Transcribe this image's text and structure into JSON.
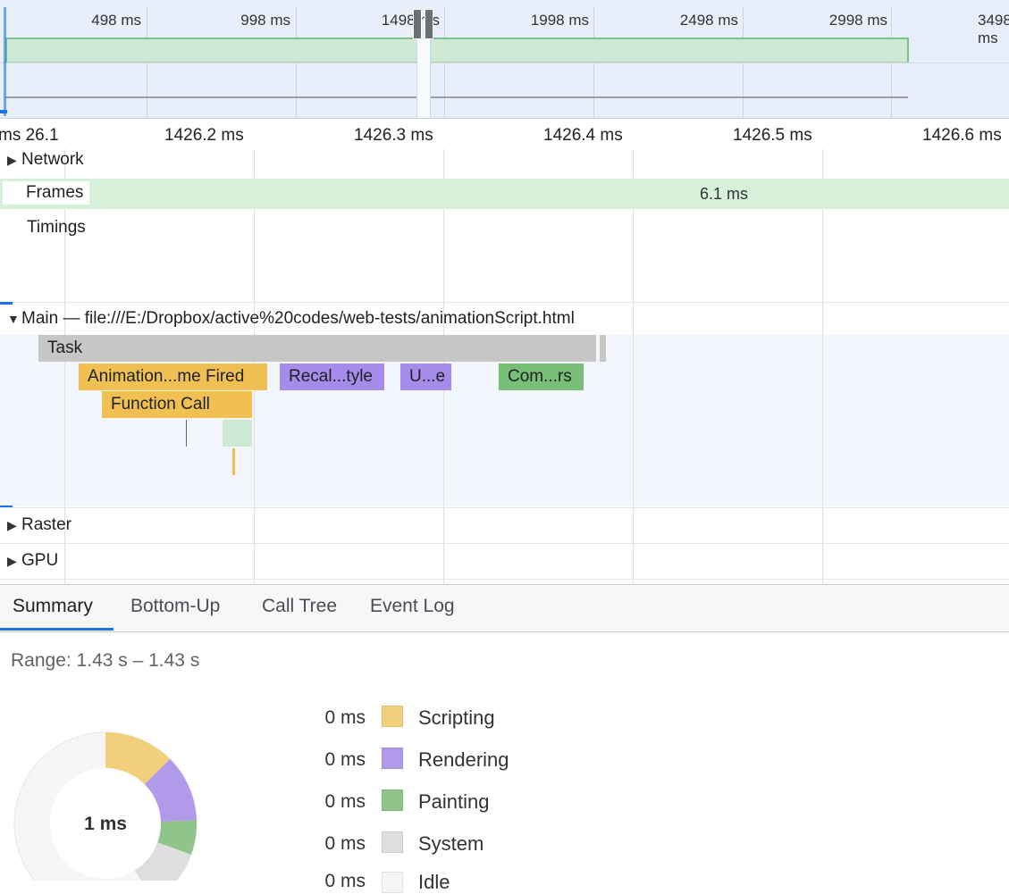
{
  "overview": {
    "ticks": [
      "498 ms",
      "998 ms",
      "1498 ms",
      "1998 ms",
      "2498 ms",
      "2998 ms",
      "3498 ms"
    ]
  },
  "ruler": {
    "labels": [
      "26.1 ms",
      "1426.2 ms",
      "1426.3 ms",
      "1426.4 ms",
      "1426.5 ms",
      "1426.6 ms"
    ]
  },
  "tracks": {
    "network": "Network",
    "frames": "Frames",
    "frames_duration": "6.1 ms",
    "timings": "Timings",
    "main": "Main — file:///E:/Dropbox/active%20codes/web-tests/animationScript.html",
    "raster": "Raster",
    "gpu": "GPU"
  },
  "flame": {
    "task": "Task",
    "animation": "Animation...me Fired",
    "recalc": "Recal...tyle",
    "update": "U...e",
    "composite": "Com...rs",
    "function_call": "Function Call"
  },
  "tabs": [
    "Summary",
    "Bottom-Up",
    "Call Tree",
    "Event Log"
  ],
  "summary": {
    "range": "Range: 1.43 s – 1.43 s",
    "total": "1 ms",
    "legend": [
      {
        "value": "0 ms",
        "name": "Scripting",
        "color": "#f2cf7a"
      },
      {
        "value": "0 ms",
        "name": "Rendering",
        "color": "#b19ae9"
      },
      {
        "value": "0 ms",
        "name": "Painting",
        "color": "#8fc48a"
      },
      {
        "value": "0 ms",
        "name": "System",
        "color": "#dedede"
      },
      {
        "value": "0 ms",
        "name": "Idle",
        "color": "#f6f6f6"
      }
    ]
  },
  "colors": {
    "accent": "#1a73e8",
    "task": "#c6c6c6",
    "scripting": "#f0c053",
    "rendering": "#a58bea",
    "painting": "#77bf76"
  }
}
